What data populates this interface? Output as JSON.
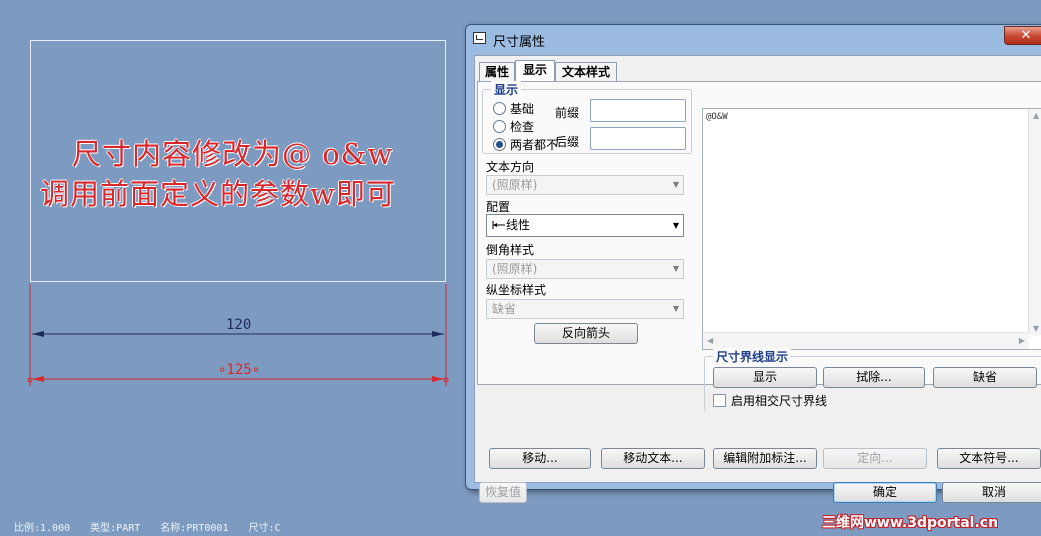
{
  "viewport": {
    "annotation_line1": "尺寸内容修改为@ o&w",
    "annotation_line2": "调用前面定义的参数w即可",
    "dim_upper": "120",
    "dim_lower": "∘125∘",
    "status": {
      "scale": "比例:1.000",
      "type": "类型:PART",
      "name": "名称:PRT0001",
      "size": "尺寸:C"
    },
    "watermark": "三维网www.3dportal.cn"
  },
  "dialog": {
    "title": "尺寸属性",
    "close_symbol": "✕",
    "tabs": [
      {
        "label": "属性",
        "active": false
      },
      {
        "label": "显示",
        "active": true
      },
      {
        "label": "文本样式",
        "active": false
      }
    ],
    "display_group": {
      "title": "显示",
      "radios": [
        {
          "label": "基础",
          "checked": false
        },
        {
          "label": "检查",
          "checked": false
        },
        {
          "label": "两者都不",
          "checked": true
        }
      ],
      "prefix_label": "前缀",
      "prefix_value": "",
      "suffix_label": "后缀",
      "suffix_value": ""
    },
    "text_direction": {
      "label": "文本方向",
      "value": "(照原样)"
    },
    "placement": {
      "label": "配置",
      "value": "线性",
      "icon": "linear-dimension-icon"
    },
    "chamfer_style": {
      "label": "倒角样式",
      "value": "(照原样)"
    },
    "ordinate_style": {
      "label": "纵坐标样式",
      "value": "缺省"
    },
    "flip_arrows_button": "反向箭头",
    "dim_text_value": "@O&W",
    "witness_group": {
      "title": "尺寸界线显示",
      "show_button": "显示",
      "erase_button": "拭除...",
      "default_button": "缺省",
      "intersect_checkbox_label": "启用相交尺寸界线",
      "intersect_checked": false
    },
    "bottom_buttons": {
      "move": "移动...",
      "move_text": "移动文本...",
      "edit_attachment": "编辑附加标注...",
      "orient": "定向...",
      "text_symbol": "文本符号...",
      "restore": "恢复值",
      "ok": "确定",
      "cancel": "取消"
    },
    "colors": {
      "accent": "#1d3f8a",
      "dimension_red": "#d9262b",
      "dimension_navy": "#1f2a5c"
    }
  }
}
